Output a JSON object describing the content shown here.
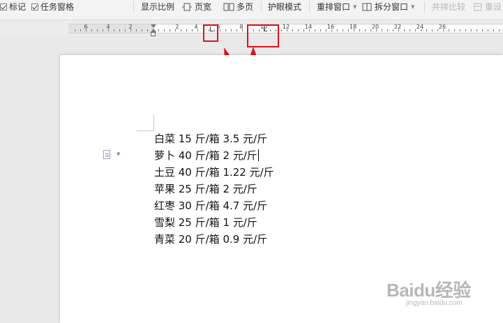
{
  "toolbar": {
    "mark_label": "标记",
    "task_pane_label": "任务窗格",
    "display_ratio_label": "显示比例",
    "page_width_label": "页宽",
    "multi_page_label": "多页",
    "eye_mode_label": "护眼模式",
    "rearrange_window_label": "重排窗口",
    "split_window_label": "拆分窗口",
    "side_by_side_label": "并排比较",
    "reset_label": "重设"
  },
  "ruler": {
    "left_numbers": [
      "6",
      "4",
      "2"
    ],
    "right_numbers": [
      "2",
      "4",
      "6",
      "8",
      "10",
      "12",
      "14",
      "16",
      "18",
      "20",
      "22",
      "24",
      "26"
    ]
  },
  "document": {
    "lines": [
      "白菜 15 斤/箱 3.5 元/斤",
      "萝卜 40 斤/箱 2 元/斤",
      "土豆 40 斤/箱 1.22 元/斤",
      "苹果 25 斤/箱 2 元/斤",
      "红枣 30 斤/箱 4.7 元/斤",
      "雪梨 25 斤/箱 1 元/斤",
      "青菜 20 斤/箱 0.9 元/斤"
    ]
  },
  "watermark": {
    "main": "Baidu经验",
    "sub": "jingyan.baidu.com"
  },
  "colors": {
    "annotation": "#e0121b",
    "page": "#ffffff",
    "background": "#e9e9e9"
  }
}
